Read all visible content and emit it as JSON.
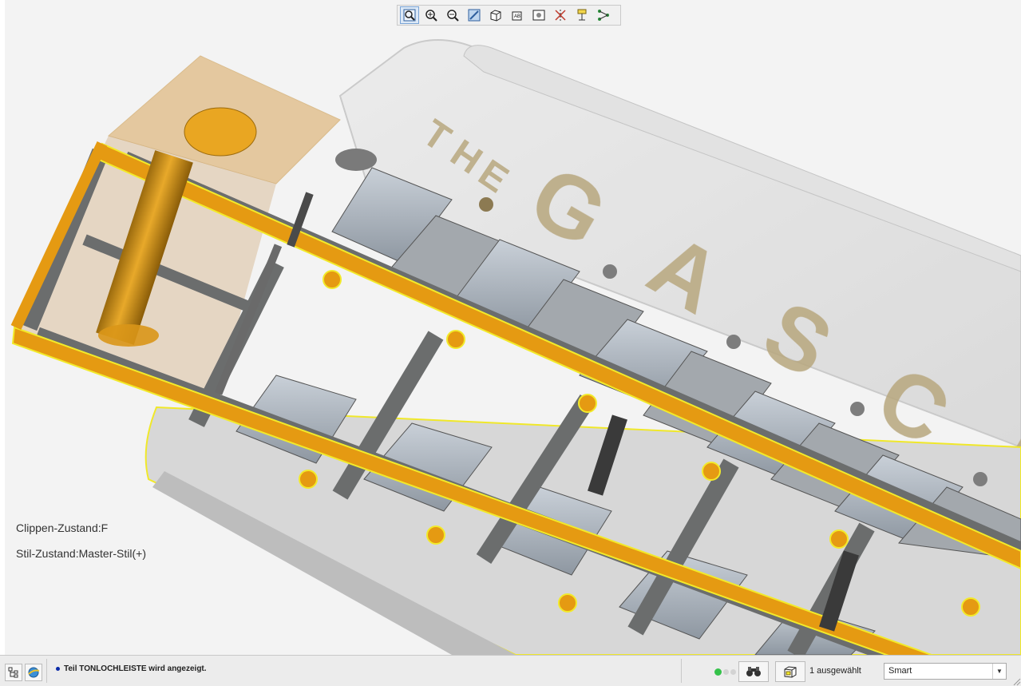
{
  "toolbar": {
    "buttons": [
      {
        "name": "refit-icon",
        "label": "Refit"
      },
      {
        "name": "zoom-in-icon",
        "label": "Zoom In"
      },
      {
        "name": "zoom-out-icon",
        "label": "Zoom Out"
      },
      {
        "name": "repaint-icon",
        "label": "Repaint"
      },
      {
        "name": "display-style-icon",
        "label": "Display Style"
      },
      {
        "name": "saved-orientations-icon",
        "label": "Saved Orientations"
      },
      {
        "name": "view-manager-icon",
        "label": "View Manager"
      },
      {
        "name": "datum-display-icon",
        "label": "Datum Display"
      },
      {
        "name": "annotation-display-icon",
        "label": "Annotation Display"
      },
      {
        "name": "spin-center-icon",
        "label": "Spin Center"
      }
    ]
  },
  "viewport": {
    "clip_state": "Clippen-Zustand:F",
    "style_state": "Stil-Zustand:Master-Stil(+)",
    "model_text_letters": [
      "T",
      "H",
      "E"
    ],
    "model_text_tail": "G A S C H"
  },
  "statusbar": {
    "message": "Teil TONLOCHLEISTE wird angezeigt.",
    "selection_count": "1 ausgewählt",
    "filter_value": "Smart",
    "filter_options": [
      "Smart"
    ]
  },
  "colors": {
    "orange": "#e59a12",
    "frame_gray": "#6b6d6d",
    "highlight_yellow": "#f2ea2a",
    "accent_blue": "#1e5fb4"
  }
}
